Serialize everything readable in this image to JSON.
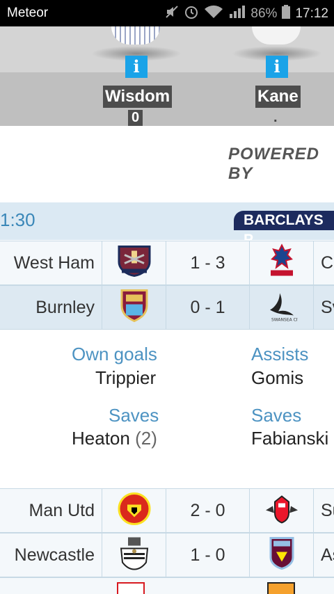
{
  "statusbar": {
    "app_name": "Meteor",
    "battery": "86%",
    "time": "17:12"
  },
  "players": [
    {
      "name": "Wisdom",
      "score": "0"
    },
    {
      "name": "Kane",
      "score": "."
    }
  ],
  "info_label": "i",
  "powered_by": "POWERED BY",
  "day_header": {
    "time": "1:30",
    "sponsor": "BARCLAYS P"
  },
  "matches": [
    {
      "home": "West Ham",
      "score": "1 - 3",
      "away": "Cr",
      "home_crest": "west-ham-crest-icon",
      "away_crest": "crystal-palace-crest-icon"
    },
    {
      "home": "Burnley",
      "score": "0 - 1",
      "away": "Sv",
      "home_crest": "burnley-crest-icon",
      "away_crest": "swansea-crest-icon"
    },
    {
      "home": "Man Utd",
      "score": "2 - 0",
      "away": "Su",
      "home_crest": "man-utd-crest-icon",
      "away_crest": "sunderland-crest-icon"
    },
    {
      "home": "Newcastle",
      "score": "1 - 0",
      "away": "As",
      "home_crest": "newcastle-crest-icon",
      "away_crest": "aston-villa-crest-icon"
    }
  ],
  "stats": {
    "own_goals_label": "Own goals",
    "own_goals_value": "Trippier",
    "assists_label": "Assists",
    "assists_value": "Gomis",
    "saves_home_label": "Saves",
    "saves_home_name": "Heaton",
    "saves_home_count": "(2)",
    "saves_away_label": "Saves",
    "saves_away_value": "Fabianski"
  },
  "colors": {
    "accent_blue": "#4d93c2",
    "info_blue": "#1aa3e8",
    "sponsor_navy": "#1d2b5e"
  }
}
